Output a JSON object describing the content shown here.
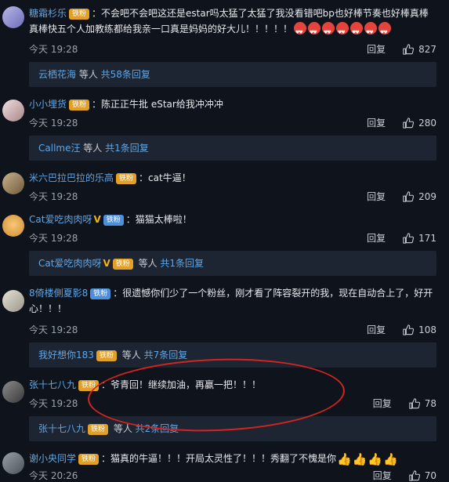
{
  "comments": [
    {
      "user": "糖霜杉乐",
      "badge": "铁粉",
      "text": "：不会吧不会吧这还是estar吗太猛了太猛了我没看错吧bp也好棒节奏也好棒真棒真棒快五个人加教练都给我亲一口真是妈妈的好大儿！！！！！",
      "time": "今天 19:28",
      "reply": "回复",
      "likes": "827",
      "sub": {
        "user": "云栖花海",
        "mid": " 等人 ",
        "more": "共58条回复"
      }
    },
    {
      "user": "小小埋货",
      "badge": "铁粉",
      "text": "：陈正正牛批 eStar给我冲冲冲",
      "time": "今天 19:28",
      "reply": "回复",
      "likes": "280",
      "sub": {
        "user": "Callme汪",
        "mid": " 等人 ",
        "more": "共1条回复"
      }
    },
    {
      "user": "米六巴拉巴拉的乐高",
      "badge": "铁粉",
      "text": "：cat牛逼！",
      "time": "今天 19:28",
      "reply": "回复",
      "likes": "209"
    },
    {
      "user": "Cat爱吃肉肉呀",
      "verified": "V",
      "badge": "铁粉",
      "text": "：猫猫太棒啦！",
      "time": "今天 19:28",
      "reply": "回复",
      "likes": "171",
      "sub": {
        "user": "Cat爱吃肉肉呀",
        "mid": " 等人 ",
        "more": "共1条回复"
      }
    },
    {
      "user": "8倚楼側夏影8",
      "badge": "铁粉",
      "text": "：很遗憾你们少了一个粉丝，刚才看了阵容裂开的我，现在自动合上了，好开心！！！",
      "time": "今天 19:28",
      "reply": "回复",
      "likes": "108",
      "sub": {
        "user": "我好想你183",
        "mid": " 等人 ",
        "more": "共7条回复"
      }
    },
    {
      "user": "张十七八九",
      "badge": "铁粉",
      "text": "：爷青回！继续加油，再赢一把！！！",
      "time": "今天 19:28",
      "reply": "回复",
      "likes": "78",
      "sub": {
        "user": "张十七八九",
        "mid": " 等人 ",
        "more": "共2条回复"
      }
    },
    {
      "user": "谢小央同学",
      "badge": "铁粉",
      "text": "：猫真的牛逼！！！开局太灵性了！！！秀翻了不愧是你",
      "time": "今天 20:26",
      "reply": "回复",
      "likes": "70"
    }
  ],
  "colors": {
    "link": "#5ea6e6",
    "badge": "#e2a126",
    "highlight": "#d6231f"
  }
}
